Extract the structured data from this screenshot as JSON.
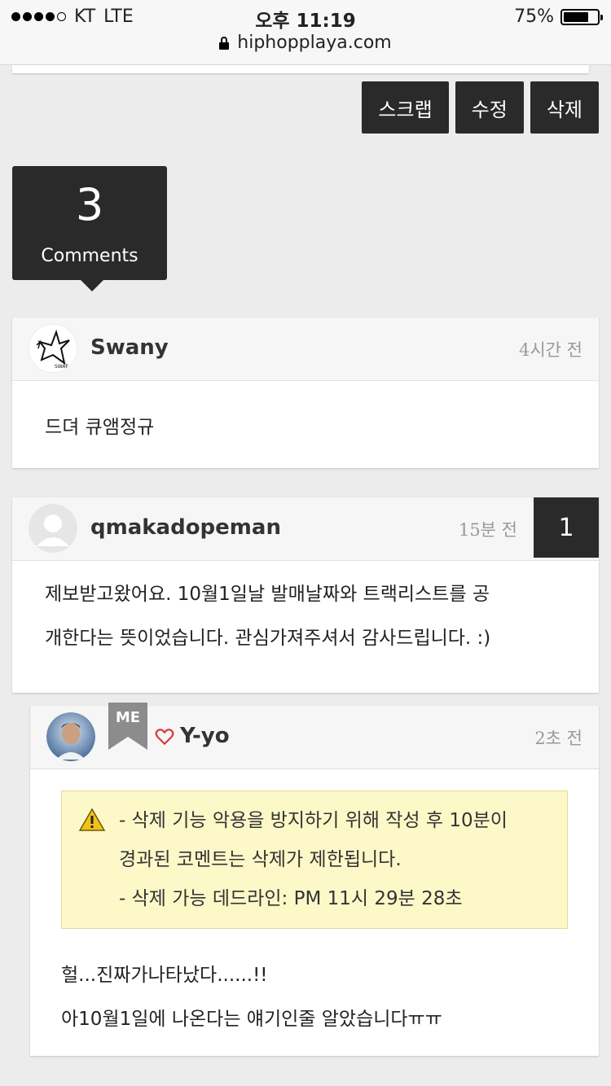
{
  "status": {
    "carrier": "KT",
    "network": "LTE",
    "time": "오후 11:19",
    "battery_label": "75%",
    "battery_level": 0.75,
    "url": "hiphopplaya.com"
  },
  "actions": {
    "scrap": "스크랩",
    "edit": "수정",
    "delete": "삭제"
  },
  "comment_count": {
    "number": "3",
    "label": "Comments"
  },
  "comments": [
    {
      "author": "Swany",
      "time": "4시간 전",
      "text": "드뎌 큐앰정규"
    },
    {
      "author": "qmakadopeman",
      "time": "15분 전",
      "votes": "1",
      "lines": [
        "제보받고왔어요.  10월1일날  발매날짜와  트랙리스트를  공",
        "개한다는 뜻이었습니다. 관심가져주셔서 감사드립니다. :)"
      ]
    }
  ],
  "reply": {
    "author": "Y-yo",
    "badge": "ME",
    "time": "2초 전",
    "notice": {
      "line1": "- 삭제 기능 악용을 방지하기 위해 작성 후 10분이",
      "line2": "경과된 코멘트는 삭제가 제한됩니다.",
      "line3": "- 삭제 가능 데드라인: PM 11시 29분 28초"
    },
    "lines": [
      "헐...진짜가나타났다......!!",
      "아10월1일에 나온다는 얘기인줄 알았습니다ㅠㅠ"
    ]
  },
  "colors": {
    "dark": "#2a2a2a",
    "notice_bg": "#fdf8c8",
    "heart": "#d9363e",
    "badge": "#8c8c8c"
  }
}
